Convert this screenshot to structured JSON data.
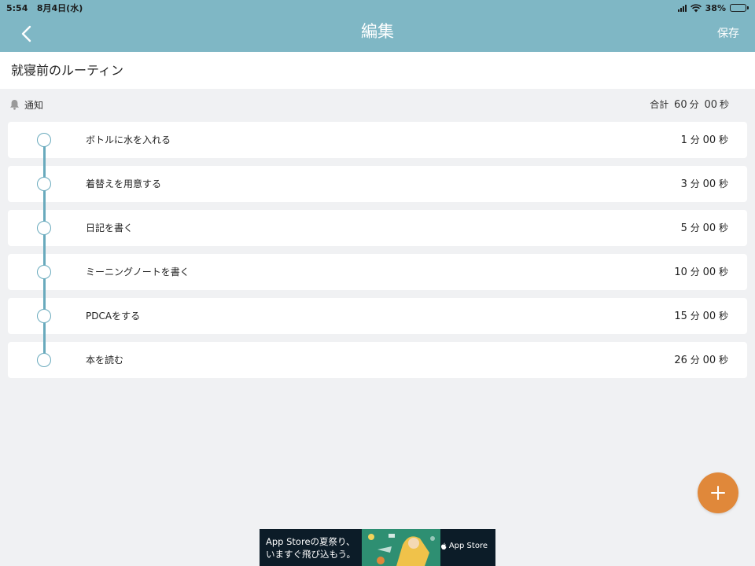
{
  "status_bar": {
    "time": "5:54",
    "date": "8月4日(水)",
    "battery": "38%",
    "battery_level": 0.38
  },
  "nav": {
    "title": "編集",
    "save_label": "保存"
  },
  "routine": {
    "title": "就寝前のルーティン"
  },
  "notify_label": "通知",
  "total": {
    "label": "合計",
    "minutes": "60",
    "min_unit": "分",
    "seconds": "00",
    "sec_unit": "秒"
  },
  "tasks": [
    {
      "name": "ボトルに水を入れる",
      "minutes": "1",
      "seconds": "00"
    },
    {
      "name": "着替えを用意する",
      "minutes": "3",
      "seconds": "00"
    },
    {
      "name": "日記を書く",
      "minutes": "5",
      "seconds": "00"
    },
    {
      "name": "ミーニングノートを書く",
      "minutes": "10",
      "seconds": "00"
    },
    {
      "name": "PDCAをする",
      "minutes": "15",
      "seconds": "00"
    },
    {
      "name": "本を読む",
      "minutes": "26",
      "seconds": "00"
    }
  ],
  "units": {
    "min": "分",
    "sec": "秒"
  },
  "ad": {
    "line1": "App Storeの夏祭り、",
    "line2": "いますぐ飛び込もう。",
    "brand": "App Store"
  },
  "colors": {
    "header": "#7fb7c5",
    "timeline": "#69aabd",
    "fab": "#e0883a",
    "background": "#f0f1f3"
  }
}
